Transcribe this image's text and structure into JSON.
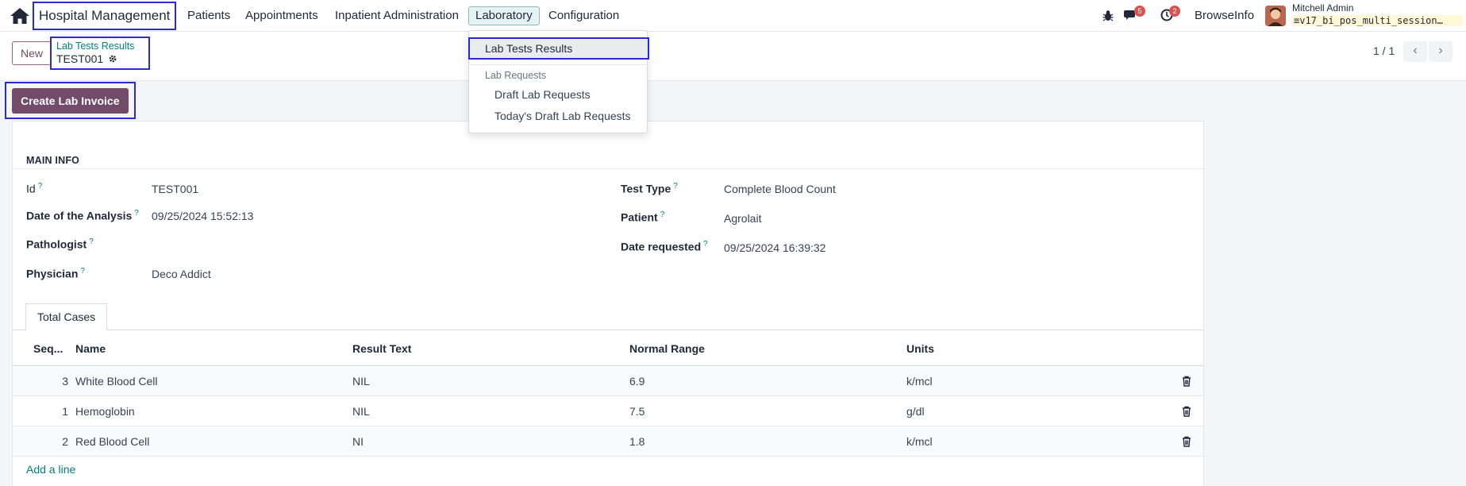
{
  "navbar": {
    "app_title": "Hospital Management",
    "menus": [
      "Patients",
      "Appointments",
      "Inpatient Administration",
      "Laboratory",
      "Configuration"
    ],
    "active_menu": "Laboratory",
    "messages_badge": "5",
    "activities_badge": "2",
    "company": "BrowseInfo",
    "user": "Mitchell Admin",
    "database": "v17_bi_pos_multi_session…"
  },
  "dropdown": {
    "active_item": "Lab Tests Results",
    "section_header": "Lab Requests",
    "items": [
      "Draft Lab Requests",
      "Today's Draft Lab Requests"
    ]
  },
  "control_panel": {
    "new_label": "New",
    "breadcrumb_parent": "Lab Tests Results",
    "breadcrumb_current": "TEST001",
    "pager": "1 / 1"
  },
  "statusbar": {
    "invoice_button": "Create Lab Invoice"
  },
  "form": {
    "section_title": "MAIN INFO",
    "help_mark": "?",
    "left_fields": [
      {
        "label": "Id",
        "value": "TEST001"
      },
      {
        "label": "Date of the Analysis",
        "value": "09/25/2024 15:52:13"
      },
      {
        "label": "Pathologist",
        "value": ""
      },
      {
        "label": "Physician",
        "value": "Deco Addict"
      }
    ],
    "right_fields": [
      {
        "label": "Test Type",
        "value": "Complete Blood Count"
      },
      {
        "label": "Patient",
        "value": "Agrolait"
      },
      {
        "label": "Date requested",
        "value": "09/25/2024 16:39:32"
      }
    ],
    "tab_label": "Total Cases",
    "table": {
      "headers": [
        "Seq...",
        "Name",
        "Result Text",
        "Normal Range",
        "Units"
      ],
      "rows": [
        {
          "seq": "3",
          "name": "White Blood Cell",
          "result": "NIL",
          "range": "6.9",
          "units": "k/mcl"
        },
        {
          "seq": "1",
          "name": "Hemoglobin",
          "result": "NIL",
          "range": "7.5",
          "units": "g/dl"
        },
        {
          "seq": "2",
          "name": "Red Blood Cell",
          "result": "NI",
          "range": "1.8",
          "units": "k/mcl"
        }
      ],
      "add_line": "Add a line"
    }
  },
  "colors": {
    "brand": "#714B67",
    "link": "#017e84",
    "highlight": "#2b2bd6",
    "badge": "#d9534f"
  },
  "icons": [
    "home-icon",
    "bug-icon",
    "chat-icon",
    "clock-icon",
    "gear-icon",
    "chevron-left-icon",
    "chevron-right-icon",
    "trash-icon",
    "database-icon"
  ]
}
